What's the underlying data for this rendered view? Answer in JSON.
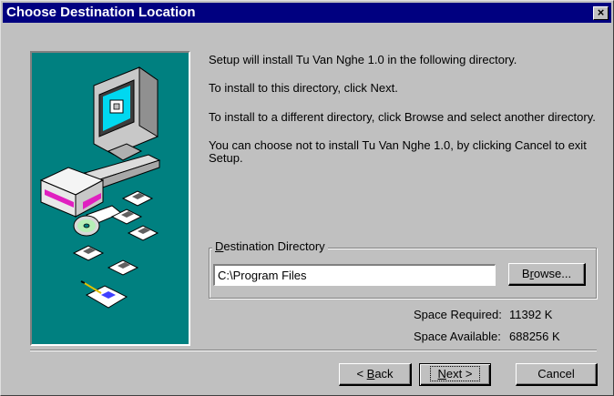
{
  "window": {
    "title": "Choose Destination Location",
    "close_glyph": "×"
  },
  "messages": [
    "Setup will install Tu Van Nghe 1.0 in the following directory.",
    "To install to this directory, click Next.",
    "To install to a different directory, click Browse and select another directory.",
    "You can choose not to install Tu Van Nghe 1.0, by clicking Cancel to exit",
    "Setup."
  ],
  "destination": {
    "group_label_accel": "D",
    "group_label_rest": "estination Directory",
    "path": "C:\\Program Files",
    "browse_accel": "r",
    "browse_pre": "B",
    "browse_post": "owse..."
  },
  "space": {
    "required_label": "Space Required:",
    "required_value": "11392 K",
    "available_label": "Space Available:",
    "available_value": "688256 K"
  },
  "buttons": {
    "back_prefix": "< ",
    "back_accel": "B",
    "back_rest": "ack",
    "next_accel": "N",
    "next_rest": "ext >",
    "cancel": "Cancel"
  },
  "colors": {
    "titlebar": "#000080",
    "dialog_face": "#c0c0c0",
    "art_background": "#008080"
  },
  "icons": [
    "computer-icon",
    "floppy-disk-icon",
    "cd-icon",
    "certificate-icon"
  ]
}
